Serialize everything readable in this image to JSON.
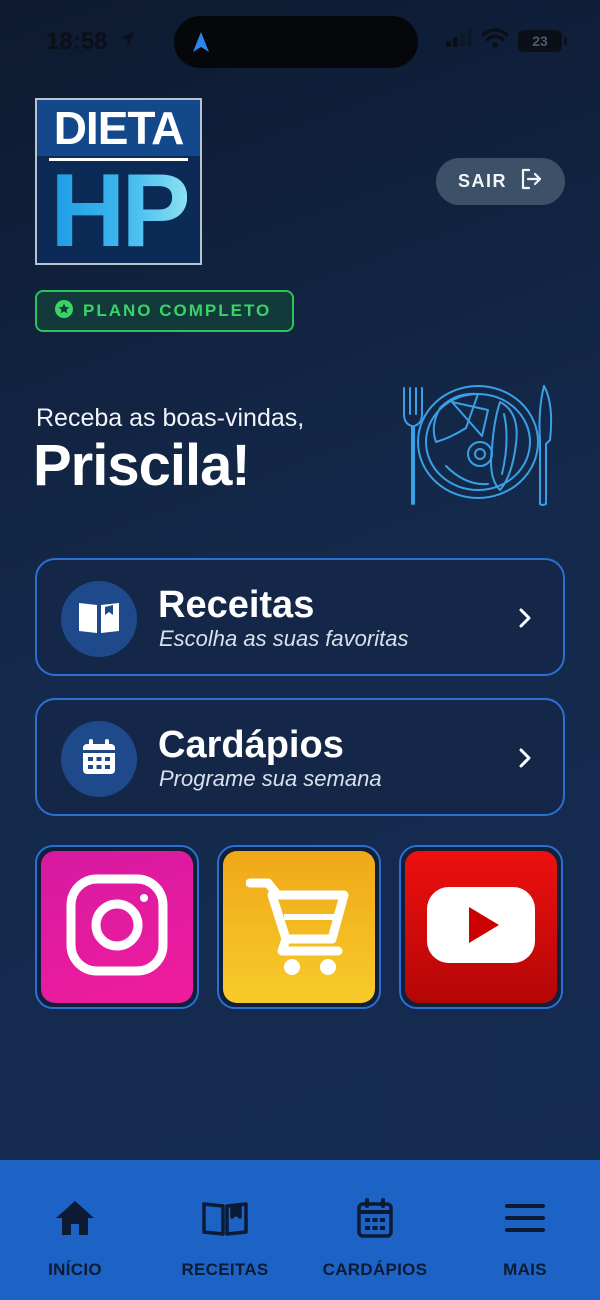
{
  "status_bar": {
    "time": "18:58",
    "battery": "23"
  },
  "logo": {
    "top_text": "DIETA",
    "bottom_text": "HP"
  },
  "header": {
    "logout_label": "SAIR"
  },
  "plan_badge": {
    "label": "PLANO COMPLETO"
  },
  "welcome": {
    "subtitle": "Receba as boas-vindas,",
    "name": "Priscila!"
  },
  "menu_cards": [
    {
      "title": "Receitas",
      "subtitle": "Escolha as suas favoritas",
      "icon": "book-icon"
    },
    {
      "title": "Cardápios",
      "subtitle": "Programe sua semana",
      "icon": "calendar-icon"
    }
  ],
  "shortcuts": [
    {
      "name": "instagram",
      "icon": "instagram-icon",
      "color": "#e61ca0"
    },
    {
      "name": "shopping-cart",
      "icon": "cart-icon",
      "color": "#f4b620"
    },
    {
      "name": "youtube",
      "icon": "youtube-icon",
      "color": "#dd0c0c"
    }
  ],
  "bottom_nav": [
    {
      "label": "INÍCIO",
      "icon": "home-icon"
    },
    {
      "label": "RECEITAS",
      "icon": "book-icon"
    },
    {
      "label": "CARDÁPIOS",
      "icon": "calendar-icon"
    },
    {
      "label": "MAIS",
      "icon": "menu-icon"
    }
  ],
  "colors": {
    "background": "#13284a",
    "accent": "#1d63c6",
    "card_border": "#2d6fd0",
    "badge_green": "#39d366"
  }
}
